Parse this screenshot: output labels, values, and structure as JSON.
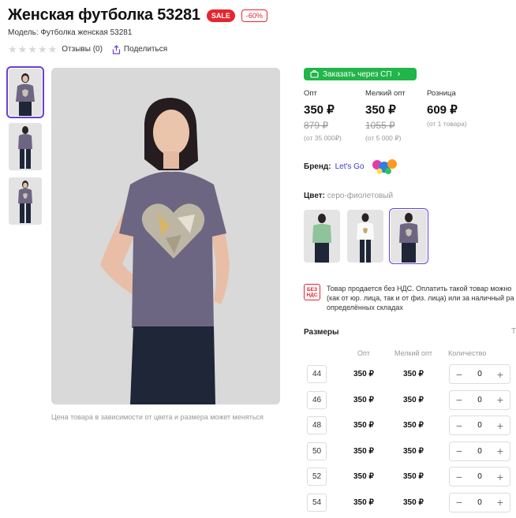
{
  "product": {
    "title": "Женская футболка 53281",
    "badge_sale": "SALE",
    "badge_discount": "-60%",
    "model": "Модель: Футболка женская 53281"
  },
  "meta": {
    "rating_stars": 0,
    "reviews": "Отзывы (0)",
    "share": "Поделиться"
  },
  "gallery": {
    "thumb_count": 3,
    "active_thumb": 0,
    "note": "Цена товара в зависимости от цвета и размера может меняться"
  },
  "order_button": "Заказать через СП",
  "prices": [
    {
      "label": "Опт",
      "value": "350 ₽",
      "old": "879 ₽",
      "condition": "(от 35 000₽)"
    },
    {
      "label": "Мелкий опт",
      "value": "350 ₽",
      "old": "1055 ₽",
      "condition": "(от 5 000 ₽)"
    },
    {
      "label": "Розница",
      "value": "609 ₽",
      "old": "",
      "condition": "(от 1 товара)"
    }
  ],
  "brand": {
    "label": "Бренд:",
    "name": "Let's Go"
  },
  "color": {
    "label": "Цвет:",
    "value": "серо-фиолетовый",
    "active_swatch": 2
  },
  "nds": {
    "badge": "БЕЗ НДС",
    "line1": "Товар продается без НДС. Оплатить такой товар можно",
    "line2": "(как от юр. лица, так и от физ. лица) или за наличный ра",
    "line3": "определённых складах"
  },
  "sizes": {
    "title": "Размеры",
    "extra": "Т",
    "headers": {
      "opt": "Опт",
      "small": "Мелкий опт",
      "qty": "Количество"
    },
    "rows": [
      {
        "size": "44",
        "opt": "350 ₽",
        "small": "350 ₽",
        "qty": "0"
      },
      {
        "size": "46",
        "opt": "350 ₽",
        "small": "350 ₽",
        "qty": "0"
      },
      {
        "size": "48",
        "opt": "350 ₽",
        "small": "350 ₽",
        "qty": "0"
      },
      {
        "size": "50",
        "opt": "350 ₽",
        "small": "350 ₽",
        "qty": "0"
      },
      {
        "size": "52",
        "opt": "350 ₽",
        "small": "350 ₽",
        "qty": "0"
      },
      {
        "size": "54",
        "opt": "350 ₽",
        "small": "350 ₽",
        "qty": "0"
      }
    ],
    "minus": "−",
    "plus": "+"
  },
  "colors": {
    "accent": "#6b3fd0",
    "sale_red": "#e5252f",
    "order_green": "#21b54a",
    "shirt_purple": "#6d6682"
  }
}
